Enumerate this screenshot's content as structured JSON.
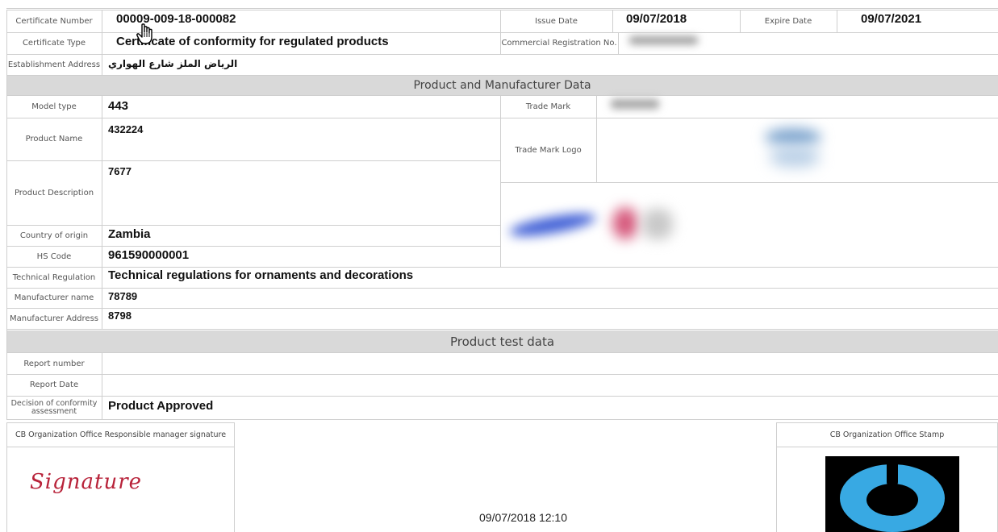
{
  "header": {
    "certificate_number_label": "Certificate  Number",
    "certificate_number": "00009-009-18-000082",
    "issue_date_label": "Issue Date",
    "issue_date": "09/07/2018",
    "expire_date_label": "Expire Date",
    "expire_date": "09/07/2021",
    "certificate_type_label": "Certificate Type",
    "certificate_type": "Certificate of conformity for regulated products",
    "commercial_registration_label": "Commercial Registration No.",
    "establishment_address_label": "Establishment Address",
    "establishment_address": "الرياض الملز شارع الهواري"
  },
  "product_section": {
    "title": "Product and Manufacturer Data",
    "model_type_label": "Model type",
    "model_type": "443",
    "trade_mark_label": "Trade Mark",
    "product_name_label": "Product Name",
    "product_name": "432224",
    "trade_mark_logo_label": "Trade Mark Logo",
    "product_description_label": "Product Description",
    "product_description": "7677",
    "country_of_origin_label": "Country of origin",
    "country_of_origin": "Zambia",
    "hs_code_label": "HS Code",
    "hs_code": "961590000001",
    "technical_regulation_label": "Technical Regulation",
    "technical_regulation": "Technical regulations for ornaments and decorations",
    "manufacturer_name_label": "Manufacturer name",
    "manufacturer_name": "78789",
    "manufacturer_address_label": "Manufacturer Address",
    "manufacturer_address": "8798"
  },
  "test_section": {
    "title": "Product test data",
    "report_number_label": "Report number",
    "report_date_label": "Report Date",
    "decision_label": "Decision of conformity assessment",
    "decision": "Product Approved"
  },
  "footer": {
    "signature_box_title": "CB Organization Office Responsible manager signature",
    "signature_text": "Signature",
    "timestamp": "09/07/2018 12:10",
    "stamp_box_title": "CB Organization Office Stamp"
  },
  "colors": {
    "stamp_blue": "#38a9e3",
    "signature_red": "#b8233a",
    "section_gray": "#d9d9d9"
  }
}
